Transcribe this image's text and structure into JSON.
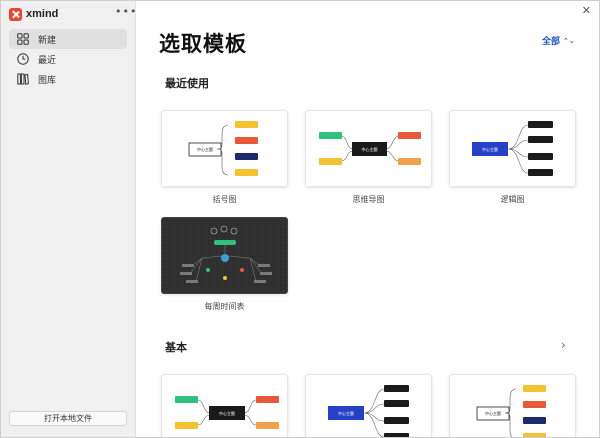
{
  "app": {
    "name": "xmind",
    "more": "•••",
    "close": "✕"
  },
  "sidebar": {
    "items": [
      {
        "label": "新建",
        "icon": "grid-icon"
      },
      {
        "label": "最近",
        "icon": "clock-icon"
      },
      {
        "label": "图库",
        "icon": "library-icon"
      }
    ],
    "open_local": "打开本地文件"
  },
  "main": {
    "title": "选取模板",
    "filter_label": "全部",
    "sections": [
      {
        "title": "最近使用",
        "cards": [
          {
            "label": "括号图",
            "center": "中心主题"
          },
          {
            "label": "思维导图",
            "center": "中心主题"
          },
          {
            "label": "逻辑图",
            "center": "中心主题"
          },
          {
            "label": "每周时间表",
            "center": ""
          }
        ]
      },
      {
        "title": "基本",
        "cards": [
          {
            "label": "",
            "center": "中心主题"
          },
          {
            "label": "",
            "center": "中心主题"
          },
          {
            "label": "",
            "center": "中心主题"
          }
        ]
      }
    ]
  },
  "colors": {
    "accent": "#1a56c8",
    "brand": "#e8452c",
    "navy": "#1b2a6b",
    "yellow": "#f2c230",
    "orange": "#f0a14a",
    "red": "#e8593c",
    "green": "#2ec27e",
    "black": "#1a1a1a"
  }
}
